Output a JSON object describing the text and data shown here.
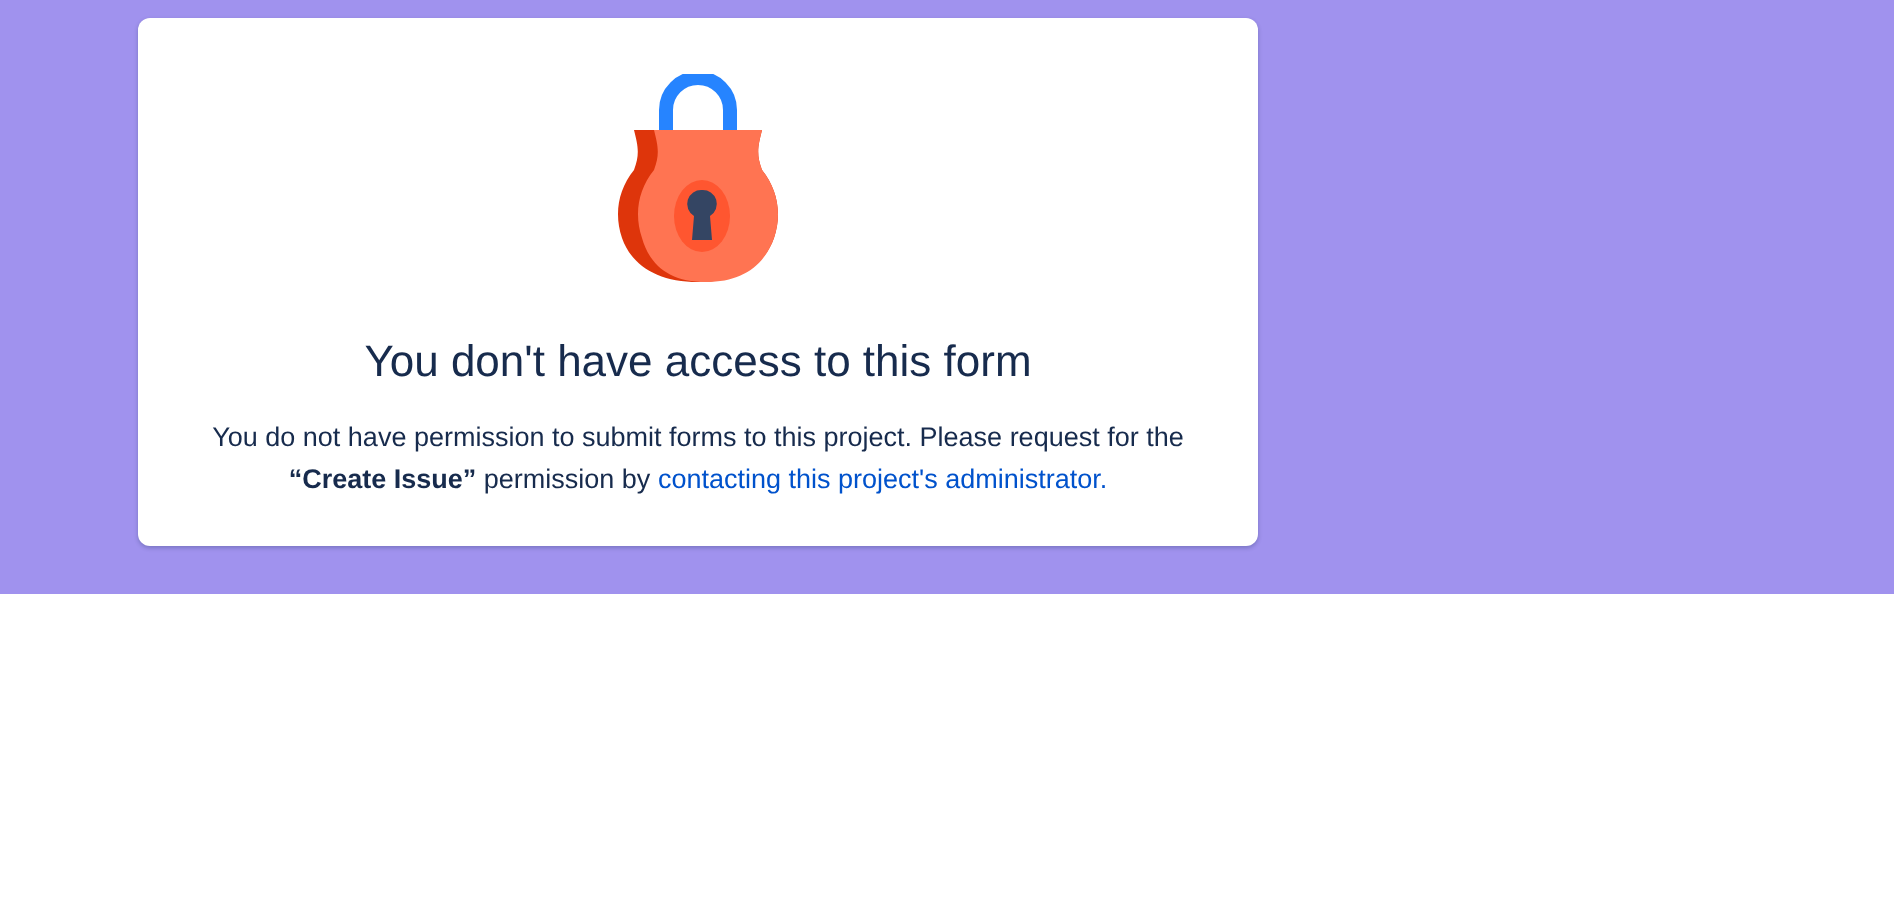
{
  "card": {
    "title": "You don't have access to this form",
    "message": "You do not have permission to submit forms to this project. Please request for the **“Create Issue”** permission by",
    "link": "contacting this project's administrator."
  }
}
